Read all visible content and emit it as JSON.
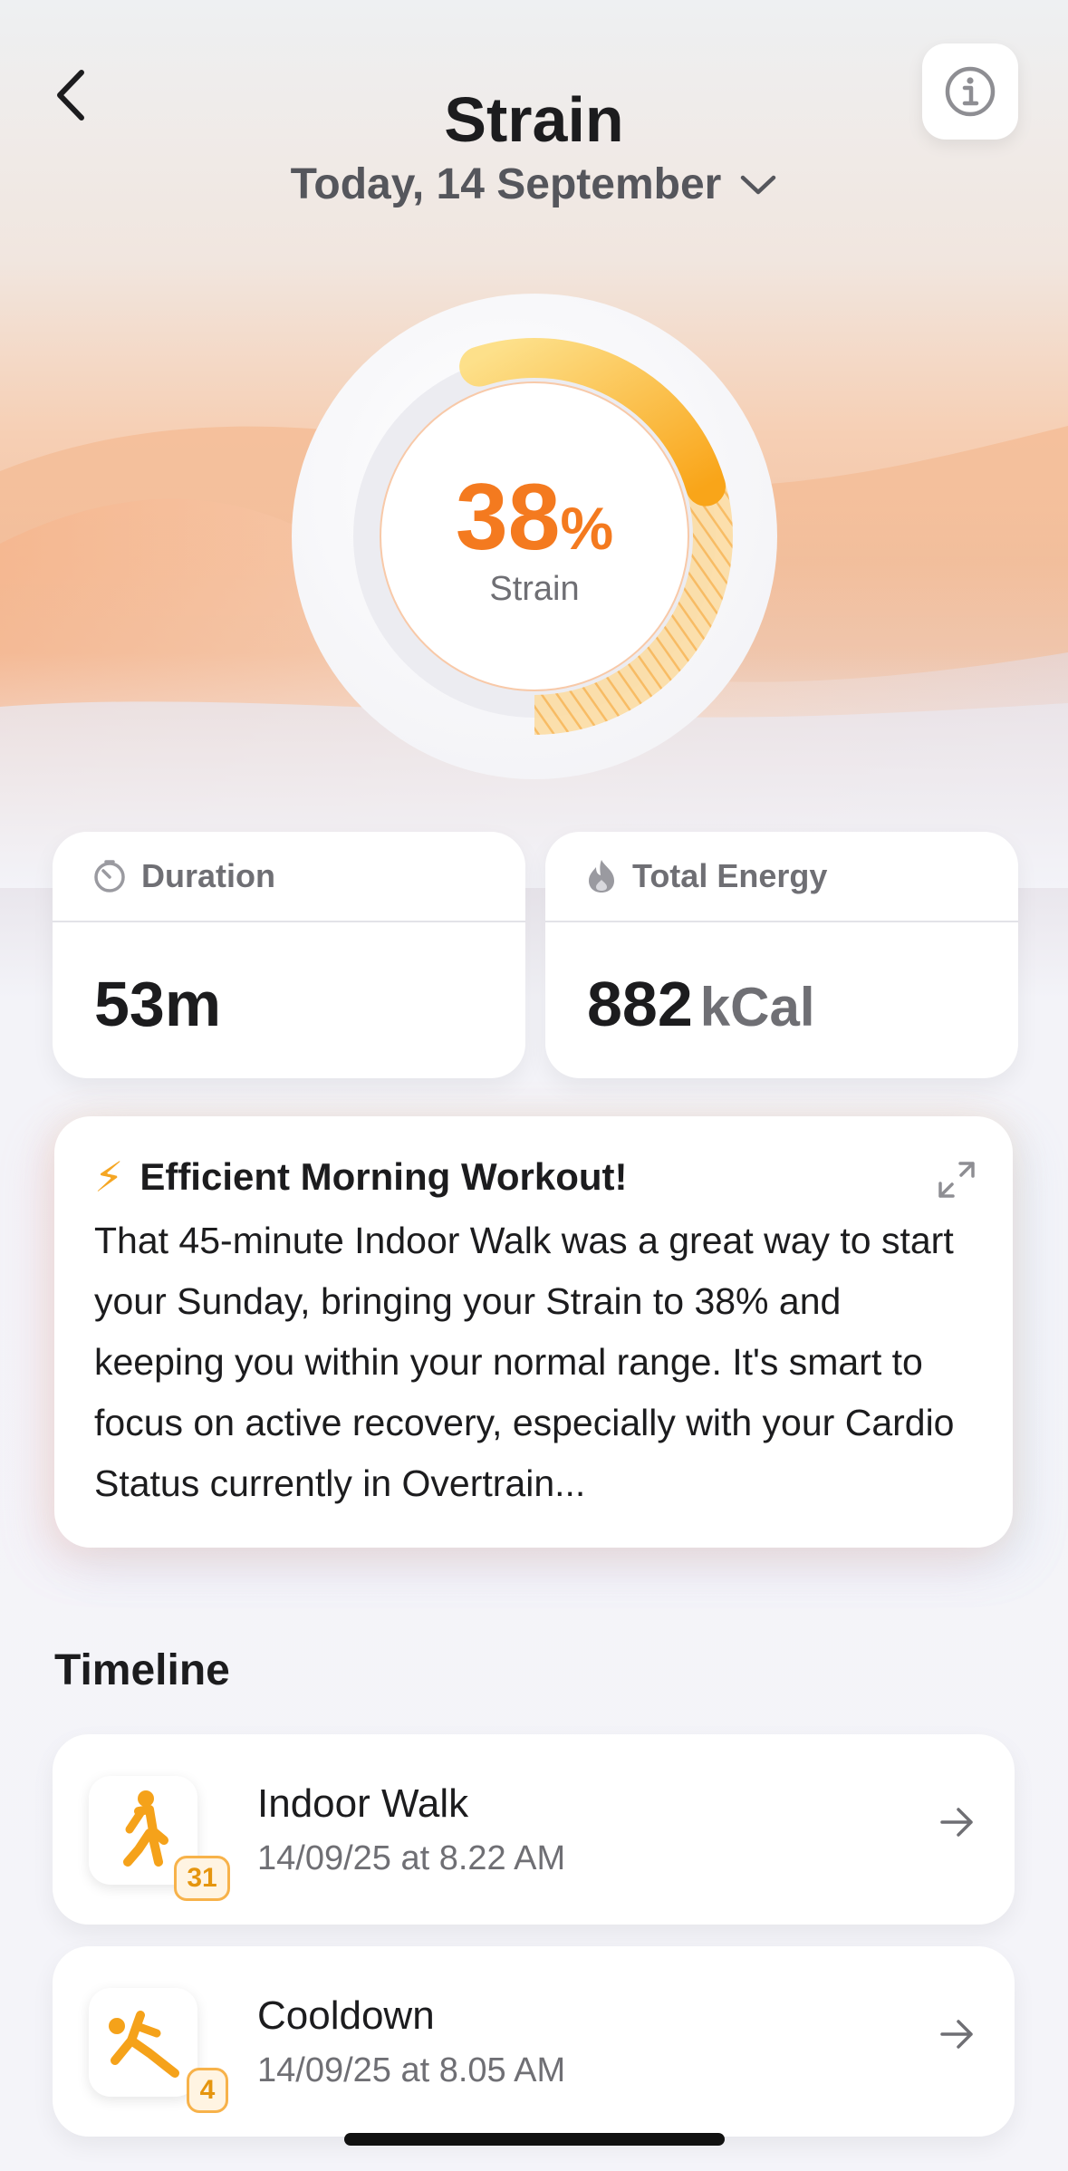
{
  "header": {
    "title": "Strain",
    "date": "Today, 14 September"
  },
  "gauge": {
    "value": "38",
    "unit": "%",
    "label": "Strain",
    "fraction": 0.38
  },
  "stats": [
    {
      "label": "Duration",
      "value": "53m",
      "unit": "",
      "icon": "stopwatch-icon"
    },
    {
      "label": "Total Energy",
      "value": "882",
      "unit": "kCal",
      "icon": "flame-icon"
    }
  ],
  "insight": {
    "emoji": "⚡",
    "title": "Efficient Morning Workout!",
    "body": "That 45-minute Indoor Walk was a great way to start your Sunday, bringing your Strain to 38% and keeping you within your normal range. It's smart to focus on active recovery, especially with your Cardio Status currently in Overtrain..."
  },
  "timeline": {
    "title": "Timeline",
    "items": [
      {
        "name": "Indoor Walk",
        "time": "14/09/25 at 8.22 AM",
        "badge": "31",
        "icon": "walking-icon"
      },
      {
        "name": "Cooldown",
        "time": "14/09/25 at 8.05 AM",
        "badge": "4",
        "icon": "stretching-icon"
      }
    ]
  },
  "colors": {
    "accent": "#f47a1f",
    "gauge_fill": "#fbb02a",
    "badge": "#f7b24a"
  }
}
